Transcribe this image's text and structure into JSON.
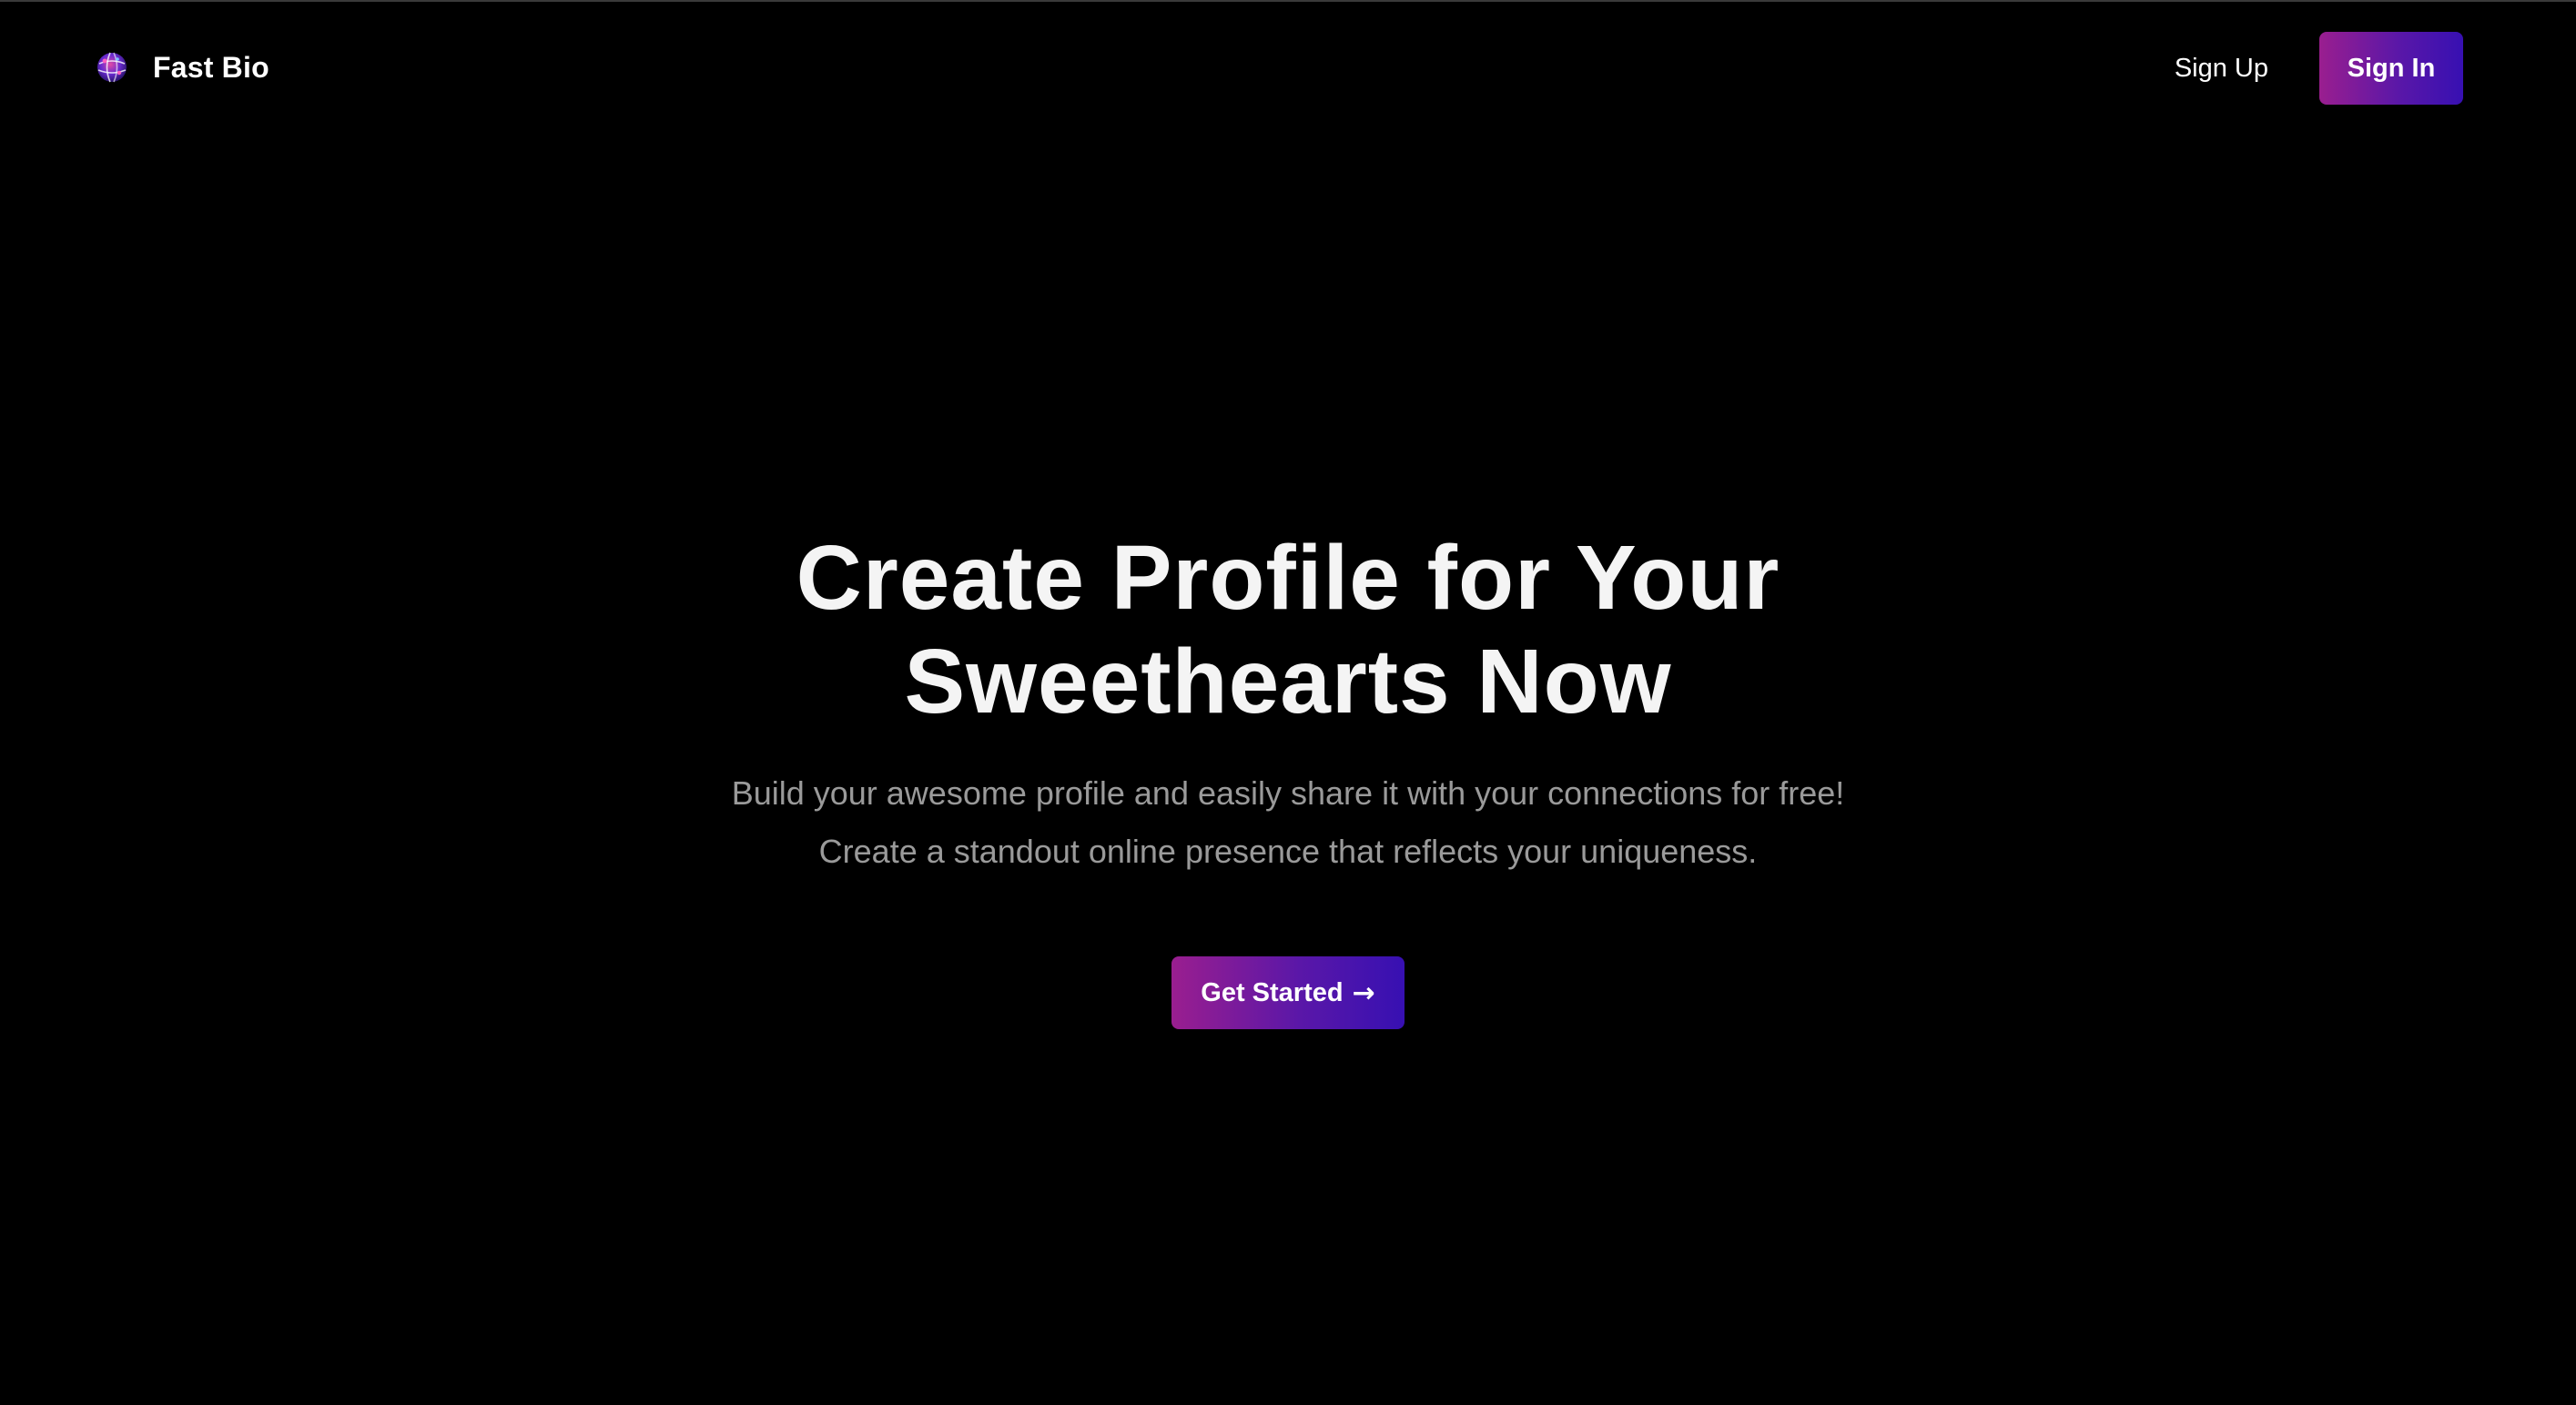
{
  "header": {
    "brand_name": "Fast Bio",
    "logo_icon": "globe-logo-icon",
    "nav": {
      "signup_label": "Sign Up",
      "signin_label": "Sign In"
    }
  },
  "hero": {
    "title_line1": "Create Profile for Your",
    "title_line2": "Sweethearts Now",
    "subtitle_line1": "Build your awesome profile and easily share it with your connections for free!",
    "subtitle_line2": "Create a standout online presence that reflects your uniqueness.",
    "cta_label": "Get Started",
    "cta_icon": "arrow-right-icon",
    "cta_arrow_glyph": "→"
  },
  "colors": {
    "background": "#000000",
    "gradient_start": "#9a1e8f",
    "gradient_end": "#3710b2",
    "text_primary": "#ffffff",
    "text_muted": "#9a9a9a"
  }
}
